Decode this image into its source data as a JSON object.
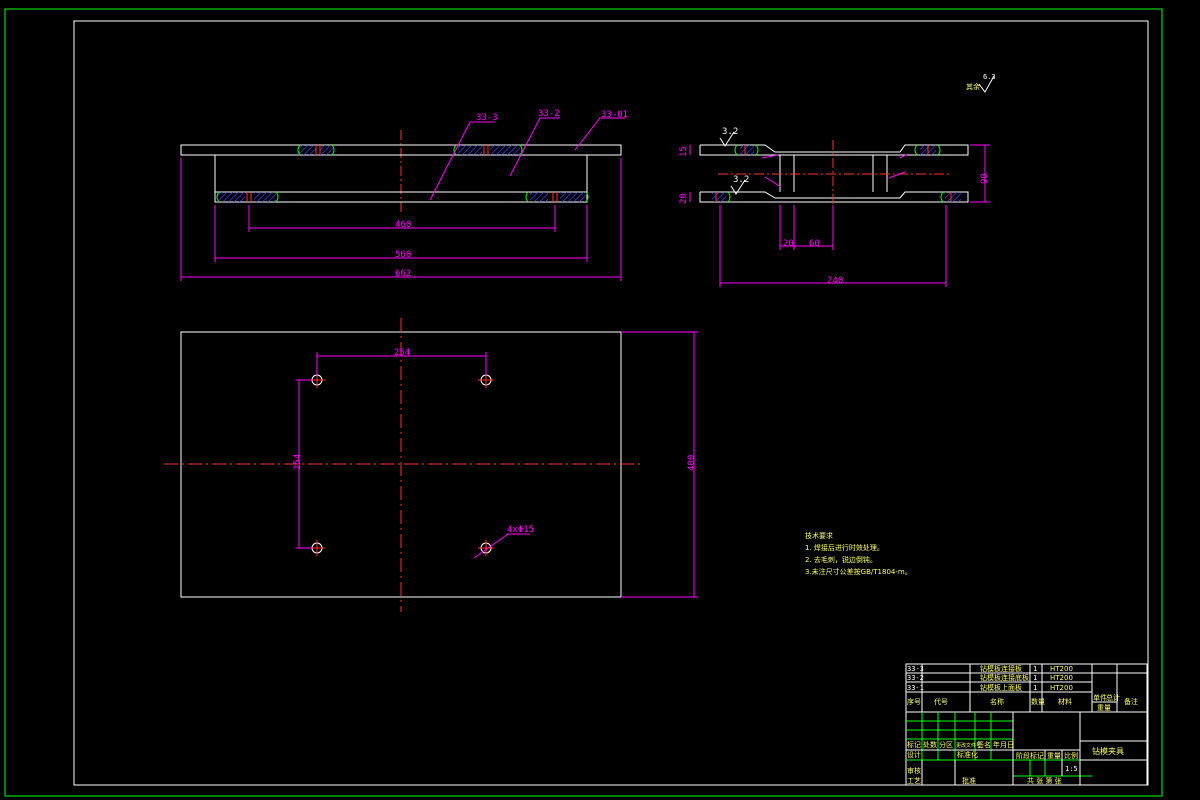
{
  "colors": {
    "background": "#000000",
    "outer_frame": "#00ff00",
    "inner_frame": "#ffffff",
    "geometry": "#ffffff",
    "dimensions": "#ff00ff",
    "centerlines": "#ff0000",
    "notes": "#ffff66",
    "hatch": "#0000ff",
    "weld": "#00ff00"
  },
  "front_view": {
    "labels": {
      "a": "33-3",
      "b": "33-2",
      "c": "33-01"
    },
    "dims": {
      "inner": "460",
      "middle": "560",
      "overall": "662"
    }
  },
  "side_view": {
    "roughness_top": "3.2",
    "roughness_bottom": "3.2",
    "dims": {
      "top_thk": "15",
      "bottom_thk": "20",
      "height": "90",
      "gap_a": "20",
      "gap_b": "60",
      "width": "240"
    }
  },
  "top_view": {
    "dims": {
      "spacing_x": "254",
      "spacing_y": "254",
      "height": "400",
      "holes": "4xΦ15"
    }
  },
  "roughness_general": {
    "symbol_value": "6.3",
    "label": "其余"
  },
  "technical_requirements": {
    "title": "技术要求",
    "items": [
      "1. 焊接后进行时效处理。",
      "2. 去毛刺，锐边倒钝。",
      "3.未注尺寸公差按GB/T1804-m。"
    ]
  },
  "title_block": {
    "parts": [
      {
        "code": "33-3",
        "name": "钻模板连接板",
        "qty": "1",
        "material": "HT200"
      },
      {
        "code": "33-2",
        "name": "钻模板连接底板",
        "qty": "1",
        "material": "HT200"
      },
      {
        "code": "33-1",
        "name": "钻模板上面板",
        "qty": "1",
        "material": "HT200"
      }
    ],
    "header": {
      "seq": "序号",
      "code": "代号",
      "name": "名称",
      "qty": "数量",
      "material": "材料",
      "unit_weight": "单件",
      "total_weight": "总计",
      "weight": "重量",
      "remark": "备注"
    },
    "signatures": {
      "mark": "标记",
      "count": "处数",
      "zone": "分区",
      "change_doc": "更改文件号",
      "signature": "签名",
      "date": "年月日",
      "designer": "设计",
      "standardize": "标准化",
      "stage_mark": "阶段标记",
      "weight_lbl": "重量",
      "scale": "比例",
      "review": "审核",
      "process": "工艺",
      "approve": "批准",
      "sheet_info": "共 张 第 张",
      "scale_value": "1:5"
    },
    "drawing_title": "钻模夹具"
  }
}
